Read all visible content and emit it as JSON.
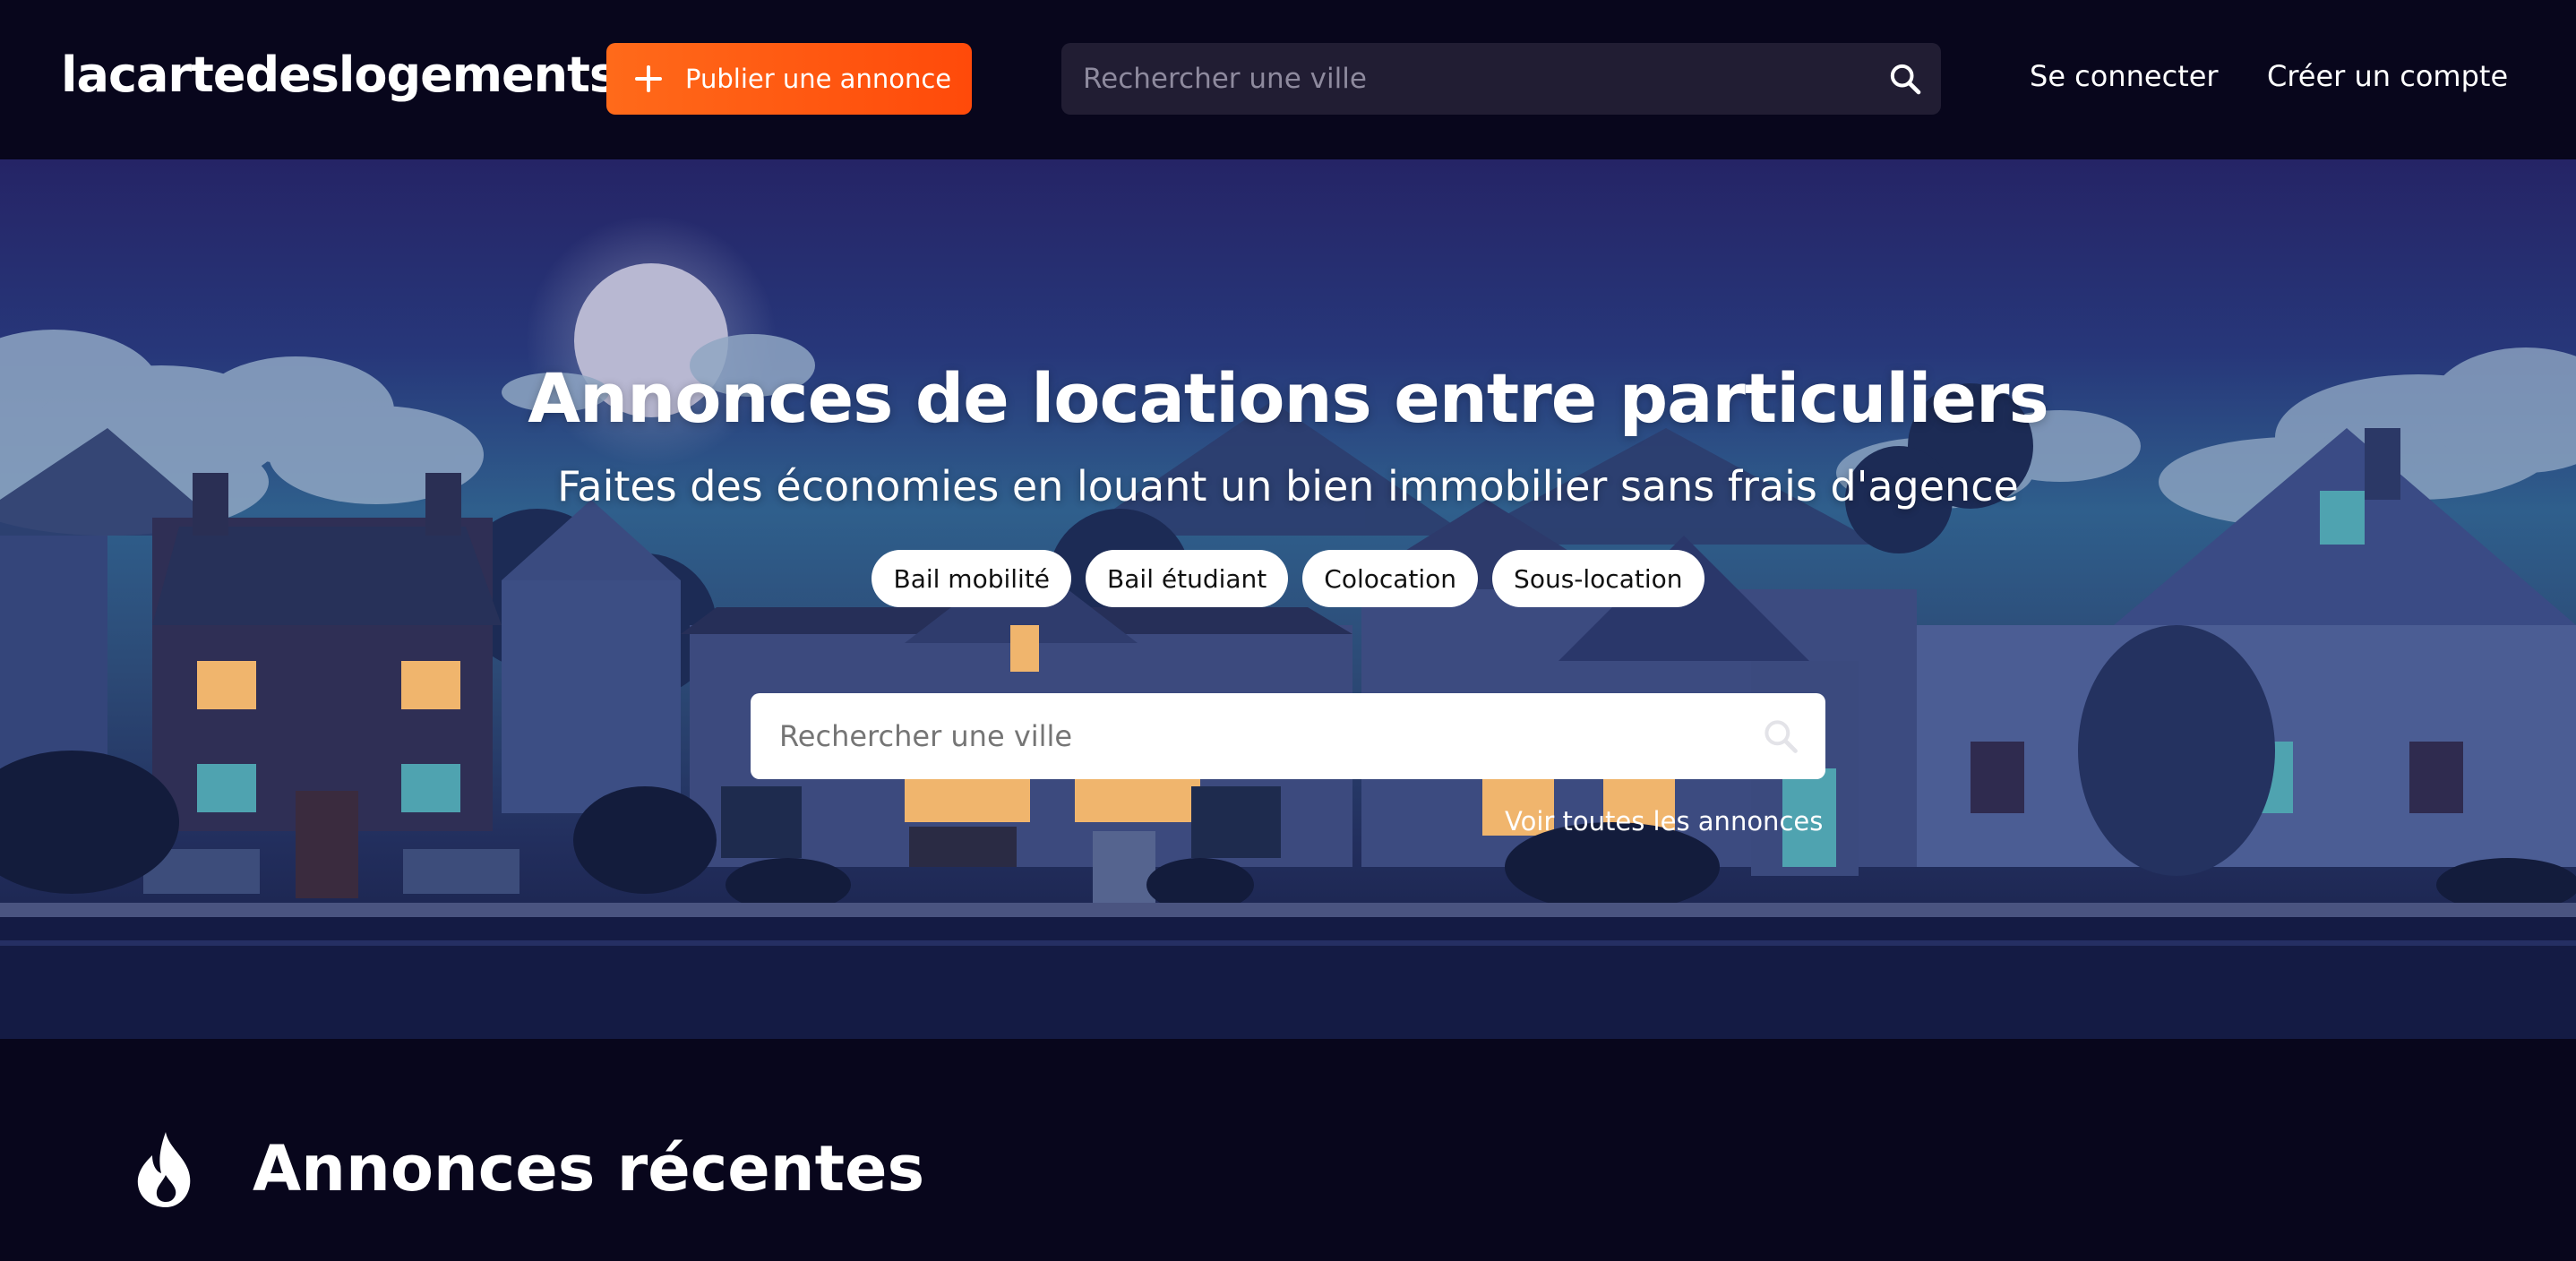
{
  "header": {
    "logo": "lacartedeslogements",
    "publish_label": "Publier une annonce",
    "search_placeholder": "Rechercher une ville",
    "login_label": "Se connecter",
    "register_label": "Créer un compte"
  },
  "hero": {
    "title": "Annonces de locations entre particuliers",
    "subtitle": "Faites des économies en louant un bien immobilier sans frais d'agence",
    "chips": [
      "Bail mobilité",
      "Bail étudiant",
      "Colocation",
      "Sous-location"
    ],
    "search_placeholder": "Rechercher une ville",
    "see_all_label": "Voir toutes les annonces"
  },
  "recent": {
    "title": "Annonces récentes"
  },
  "colors": {
    "background": "#08061c",
    "accent": "#ff5a14",
    "search_dark": "#211d33"
  },
  "icons": {
    "publish": "plus-icon",
    "search": "search-icon",
    "recent": "flame-icon"
  }
}
